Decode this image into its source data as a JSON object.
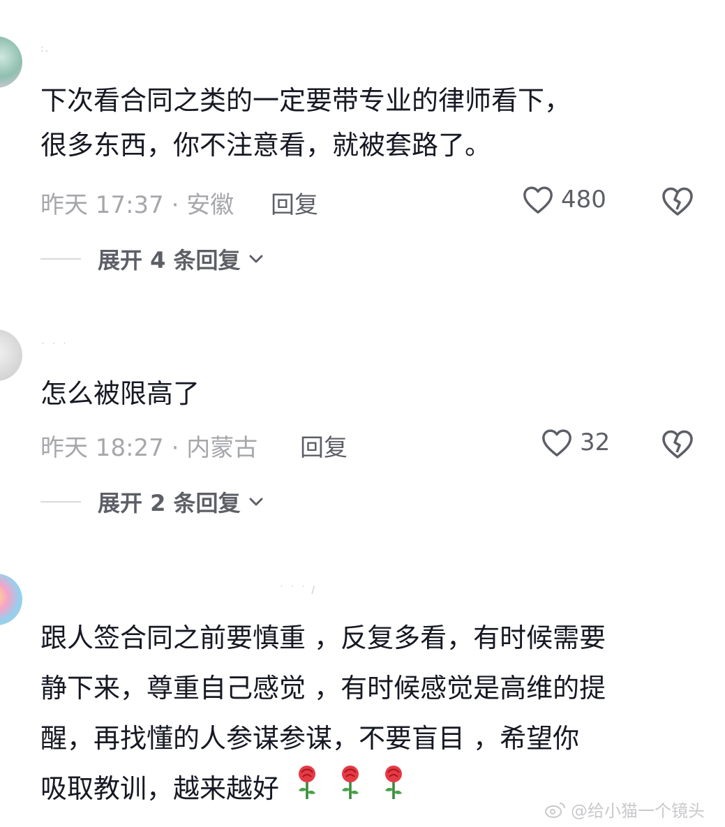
{
  "comments": [
    {
      "username": "​:.",
      "text_lines": [
        "下次看合同之类的一定要带专业的律师看下，",
        "很多东西，你不注意看，就被套路了。"
      ],
      "time": "昨天 17:37 · 安徽",
      "reply_label": "回复",
      "likes": "480",
      "expand_label": "展开 4 条回复"
    },
    {
      "username": "˙ ˙ ˙",
      "text_lines": [
        "怎么被限高了"
      ],
      "time": "昨天 18:27 · 内蒙古",
      "reply_label": "回复",
      "likes": "32",
      "expand_label": "展开 2 条回复"
    },
    {
      "username": "˙ ˙ ˙ /",
      "text_lines": [
        "跟人签合同之前要慎重 ，反复多看，有时候需要",
        "静下来，尊重自己感觉 ，有时候感觉是高维的提",
        "醒，再找懂的人参谋参谋，不要盲目 ，希望你",
        "吸取教训，越来越好"
      ],
      "emoji_icons": [
        "rose-icon",
        "rose-icon",
        "rose-icon"
      ]
    }
  ],
  "watermark": "@给小猫一个镜头",
  "colors": {
    "text": "#161823",
    "meta": "#a6a7ab",
    "action": "#5d5f66",
    "divider": "#d8d9dc"
  }
}
